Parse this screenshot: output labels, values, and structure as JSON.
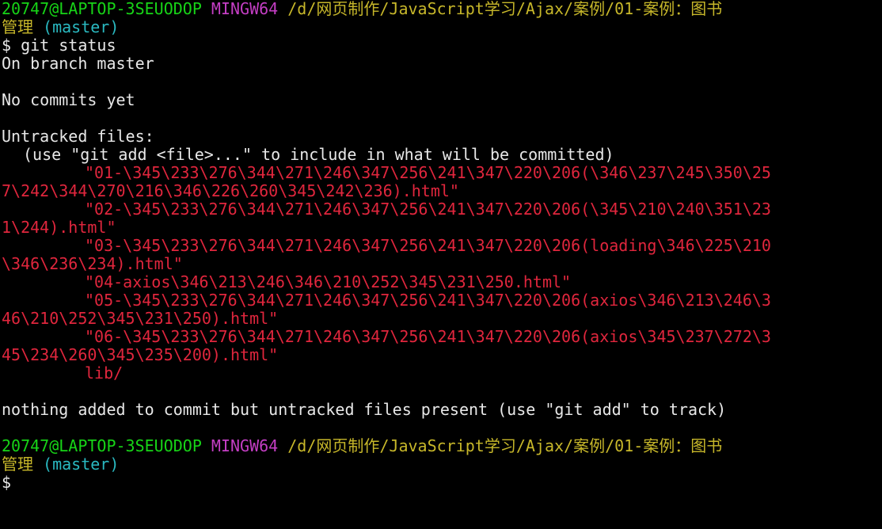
{
  "prompt1": {
    "user_host": "20747@LAPTOP-3SEUODOP",
    "system": "MINGW64",
    "path_line1": "/d/网页制作/JavaScript学习/Ajax/案例/01-案例：图书",
    "path_line2": "管理",
    "branch": "(master)"
  },
  "command": "$ git status",
  "output": {
    "branch_line": "On branch master",
    "commits_line": "No commits yet",
    "untracked_header": "Untracked files:",
    "untracked_hint": "(use \"git add <file>...\" to include in what will be committed)",
    "file_lines": [
      "\"01-\\345\\233\\276\\344\\271\\246\\347\\256\\241\\347\\220\\206(\\346\\237\\245\\350\\25",
      "7\\242\\344\\270\\216\\346\\226\\260\\345\\242\\236).html\"",
      "\"02-\\345\\233\\276\\344\\271\\246\\347\\256\\241\\347\\220\\206(\\345\\210\\240\\351\\23",
      "1\\244).html\"",
      "\"03-\\345\\233\\276\\344\\271\\246\\347\\256\\241\\347\\220\\206(loading\\346\\225\\210",
      "\\346\\236\\234).html\"",
      "\"04-axios\\346\\213\\246\\346\\210\\252\\345\\231\\250.html\"",
      "\"05-\\345\\233\\276\\344\\271\\246\\347\\256\\241\\347\\220\\206(axios\\346\\213\\246\\3",
      "46\\210\\252\\345\\231\\250).html\"",
      "\"06-\\345\\233\\276\\344\\271\\246\\347\\256\\241\\347\\220\\206(axios\\345\\237\\272\\3",
      "45\\234\\260\\345\\235\\200).html\"",
      "lib/"
    ],
    "summary_line": "nothing added to commit but untracked files present (use \"git add\" to track)"
  },
  "prompt2": {
    "user_host": "20747@LAPTOP-3SEUODOP",
    "system": "MINGW64",
    "path_line1": "/d/网页制作/JavaScript学习/Ajax/案例/01-案例：图书",
    "path_line2": "管理",
    "branch": "(master)"
  },
  "final_prompt": "$",
  "colors": {
    "background": "#000000",
    "user_host": "#17d417",
    "system": "#c43ec4",
    "path": "#c7b72a",
    "branch": "#2ab9c1",
    "untracked_files": "#e0263d",
    "default_text": "#e8e8e8"
  }
}
